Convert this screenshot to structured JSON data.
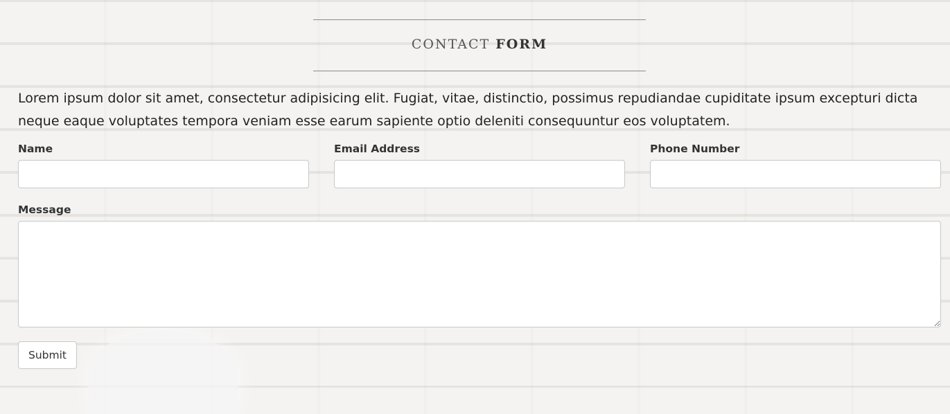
{
  "heading": {
    "light": "CONTACT",
    "bold": "FORM"
  },
  "intro": "Lorem ipsum dolor sit amet, consectetur adipisicing elit. Fugiat, vitae, distinctio, possimus repudiandae cupiditate ipsum excepturi dicta neque eaque voluptates tempora veniam esse earum sapiente optio deleniti consequuntur eos voluptatem.",
  "form": {
    "name_label": "Name",
    "name_value": "",
    "email_label": "Email Address",
    "email_value": "",
    "phone_label": "Phone Number",
    "phone_value": "",
    "message_label": "Message",
    "message_value": "",
    "submit_label": "Submit"
  }
}
